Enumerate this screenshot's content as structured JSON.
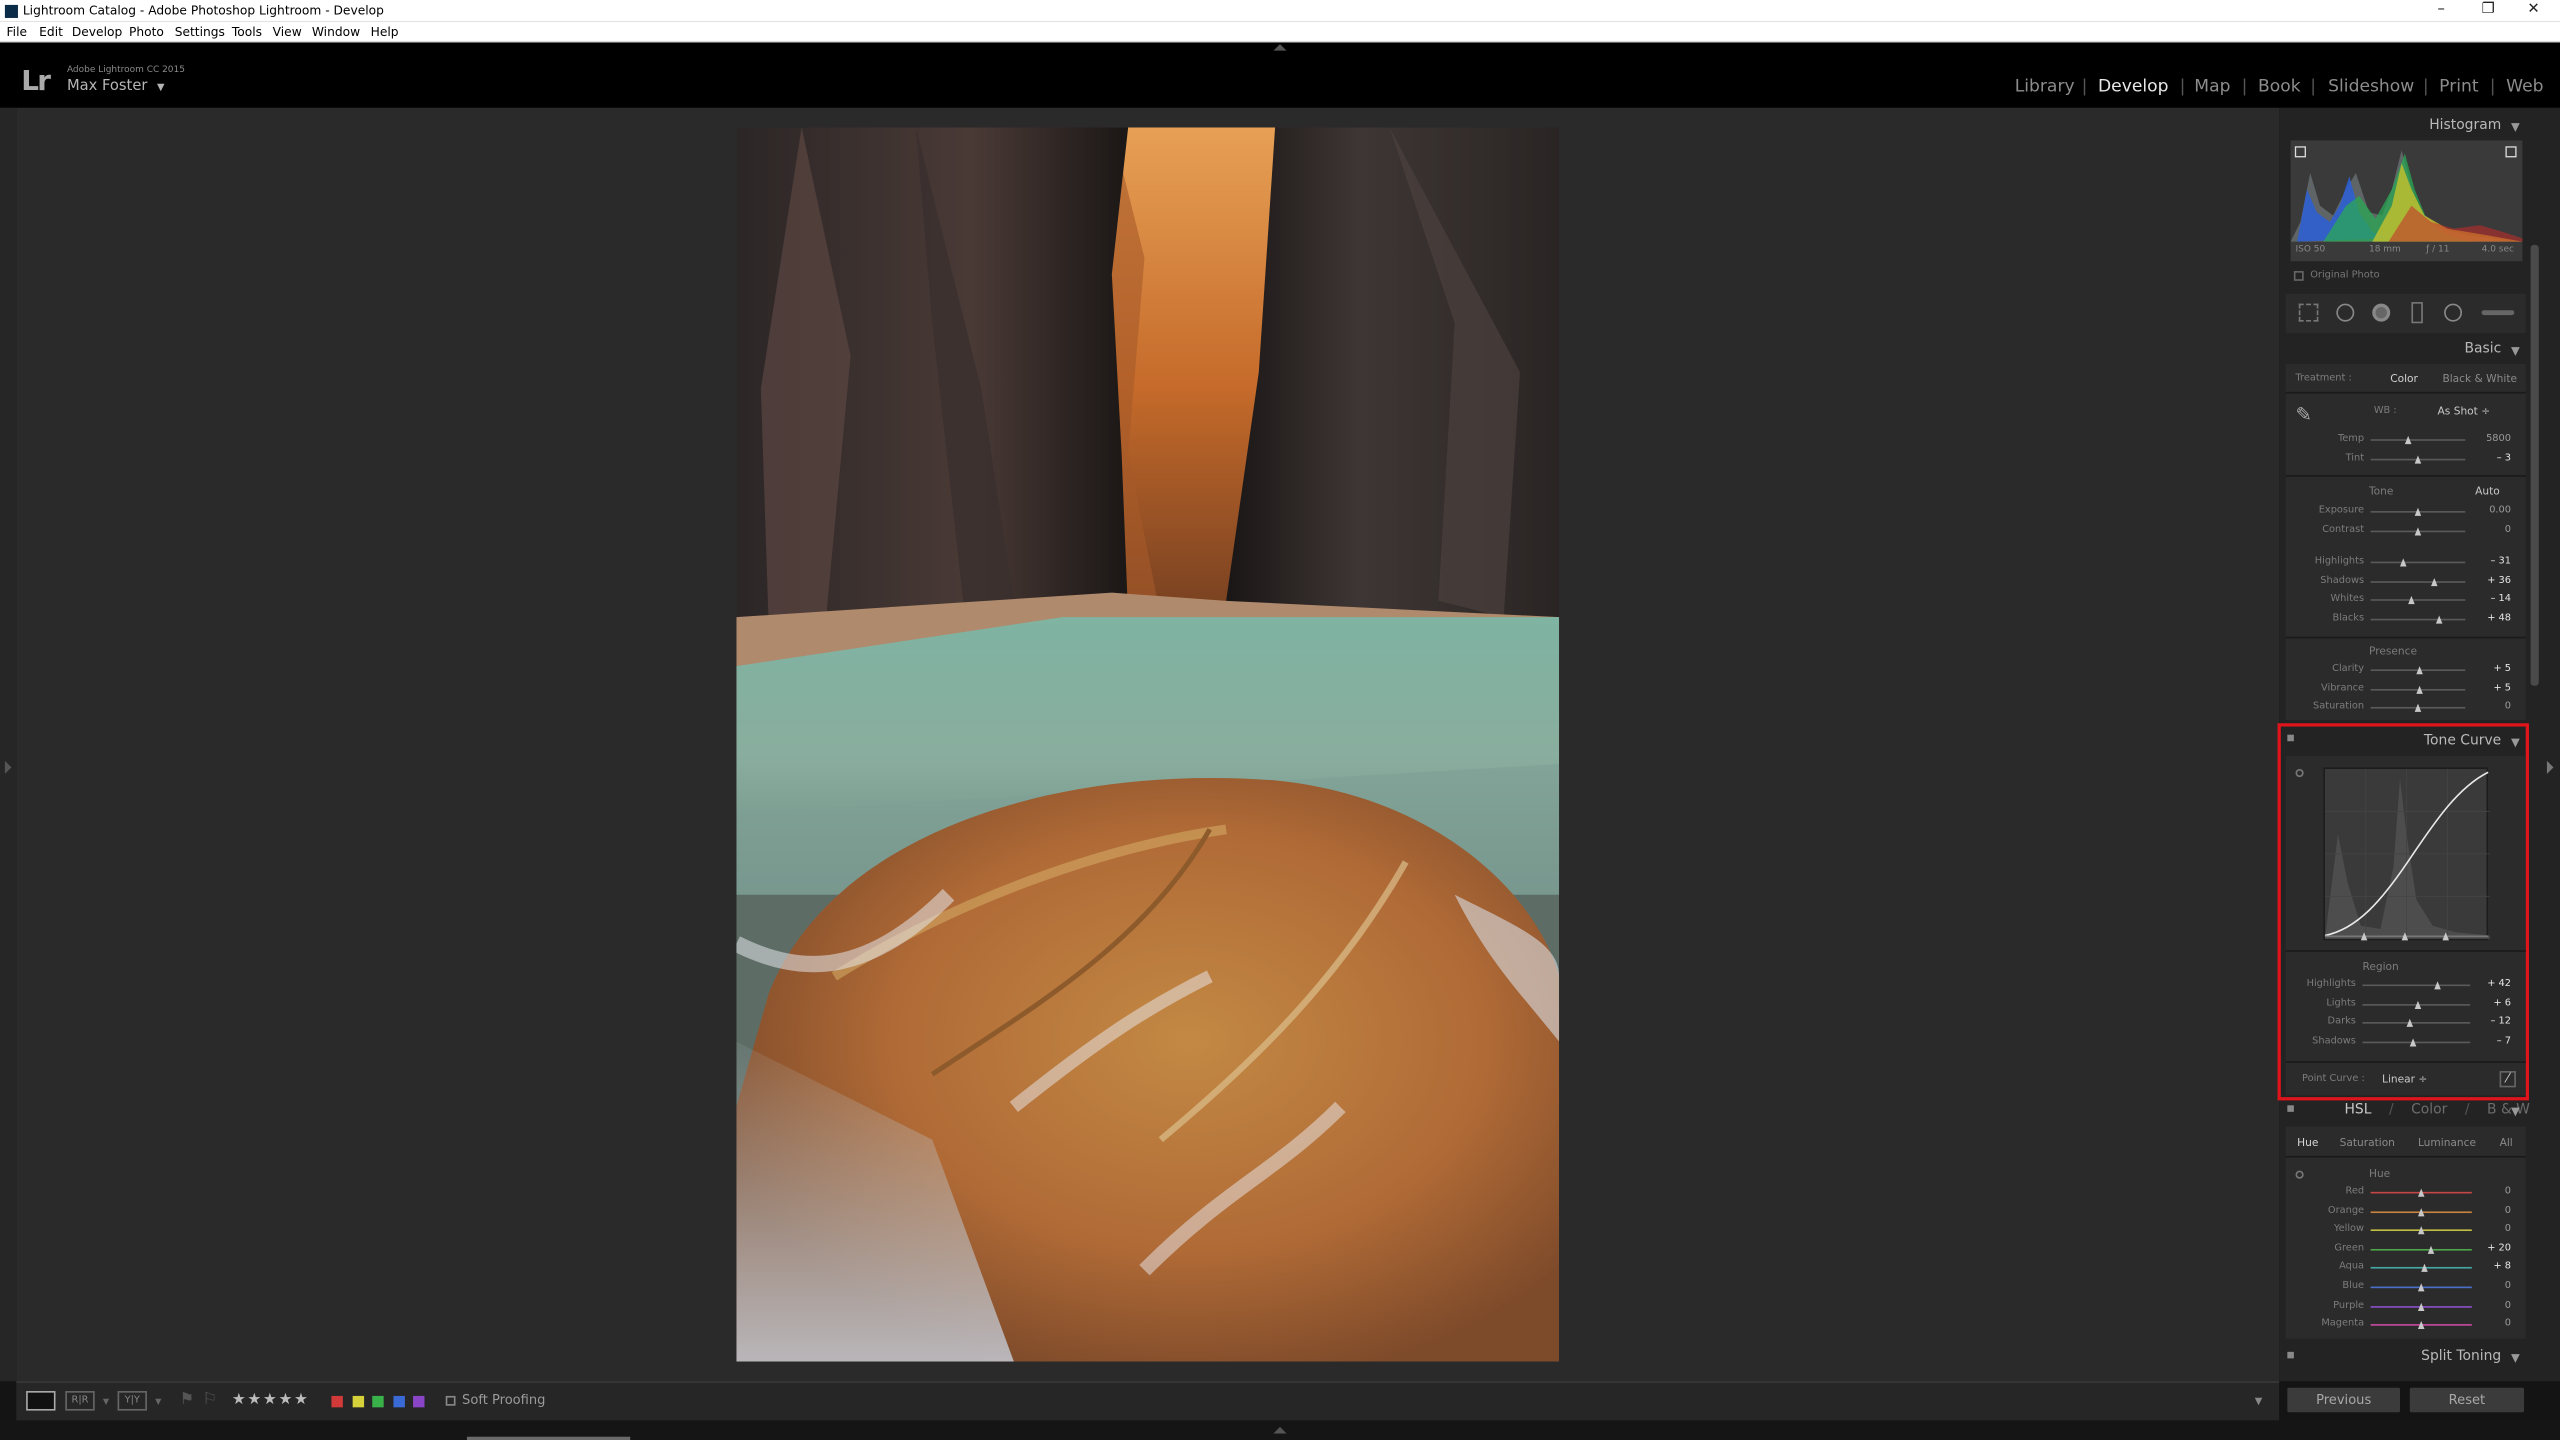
{
  "window": {
    "title": "Lightroom Catalog - Adobe Photoshop Lightroom - Develop",
    "controls": [
      "–",
      "❐",
      "✕"
    ]
  },
  "menu": [
    "File",
    "Edit",
    "Develop",
    "Photo",
    "Settings",
    "Tools",
    "View",
    "Window",
    "Help"
  ],
  "identity": {
    "logo": "Lr",
    "product": "Adobe Lightroom CC 2015",
    "user": "Max Foster",
    "user_caret": "▼"
  },
  "modules": [
    {
      "label": "Library",
      "active": false
    },
    {
      "label": "Develop",
      "active": true
    },
    {
      "label": "Map",
      "active": false
    },
    {
      "label": "Book",
      "active": false
    },
    {
      "label": "Slideshow",
      "active": false
    },
    {
      "label": "Print",
      "active": false
    },
    {
      "label": "Web",
      "active": false
    }
  ],
  "histogram": {
    "title": "Histogram",
    "iso": "ISO 50",
    "focal": "18 mm",
    "aperture": "ƒ / 11",
    "shutter": "4.0 sec",
    "original_photo": "Original Photo"
  },
  "basic": {
    "title": "Basic",
    "treatment_label": "Treatment :",
    "treatment_color": "Color",
    "treatment_bw": "Black & White",
    "wb_label": "WB :",
    "wb_value": "As Shot ÷",
    "wb": [
      {
        "label": "Temp",
        "value": "5800",
        "pos": 0.4
      },
      {
        "label": "Tint",
        "value": "– 3",
        "pos": 0.5
      }
    ],
    "tone_label": "Tone",
    "auto": "Auto",
    "tone": [
      {
        "label": "Exposure",
        "value": "0.00",
        "pos": 0.5
      },
      {
        "label": "Contrast",
        "value": "0",
        "pos": 0.5
      }
    ],
    "tone2": [
      {
        "label": "Highlights",
        "value": "– 31",
        "pos": 0.36
      },
      {
        "label": "Shadows",
        "value": "+ 36",
        "pos": 0.68
      },
      {
        "label": "Whites",
        "value": "– 14",
        "pos": 0.44
      },
      {
        "label": "Blacks",
        "value": "+ 48",
        "pos": 0.74
      }
    ],
    "presence_label": "Presence",
    "presence": [
      {
        "label": "Clarity",
        "value": "+ 5",
        "pos": 0.52
      },
      {
        "label": "Vibrance",
        "value": "+ 5",
        "pos": 0.52
      },
      {
        "label": "Saturation",
        "value": "0",
        "pos": 0.5
      }
    ]
  },
  "tone_curve": {
    "title": "Tone Curve",
    "region_label": "Region",
    "regions": [
      {
        "label": "Highlights",
        "value": "+ 42",
        "pos": 0.71
      },
      {
        "label": "Lights",
        "value": "+ 6",
        "pos": 0.53
      },
      {
        "label": "Darks",
        "value": "– 12",
        "pos": 0.44
      },
      {
        "label": "Shadows",
        "value": "– 7",
        "pos": 0.47
      }
    ],
    "point_curve_label": "Point Curve :",
    "point_curve_value": "Linear ÷",
    "highlight_color": "#e0141b"
  },
  "hsl": {
    "title_hsl": "HSL",
    "sep": "/",
    "title_color": "Color",
    "title_bw": "B & W",
    "tabs": [
      {
        "label": "Hue",
        "active": true
      },
      {
        "label": "Saturation",
        "active": false
      },
      {
        "label": "Luminance",
        "active": false
      },
      {
        "label": "All",
        "active": false
      }
    ],
    "section_label": "Hue",
    "rows": [
      {
        "label": "Red",
        "value": "0",
        "pos": 0.5,
        "color": "#c64646"
      },
      {
        "label": "Orange",
        "value": "0",
        "pos": 0.5,
        "color": "#c8843e"
      },
      {
        "label": "Yellow",
        "value": "0",
        "pos": 0.5,
        "color": "#c3bf44"
      },
      {
        "label": "Green",
        "value": "+ 20",
        "pos": 0.6,
        "color": "#4fa64a"
      },
      {
        "label": "Aqua",
        "value": "+ 8",
        "pos": 0.54,
        "color": "#44a8a4"
      },
      {
        "label": "Blue",
        "value": "0",
        "pos": 0.5,
        "color": "#4a6fc6"
      },
      {
        "label": "Purple",
        "value": "0",
        "pos": 0.5,
        "color": "#8a50c6"
      },
      {
        "label": "Magenta",
        "value": "0",
        "pos": 0.5,
        "color": "#c64aa0"
      }
    ]
  },
  "split_toning": {
    "title": "Split Toning"
  },
  "buttons": {
    "previous": "Previous",
    "reset": "Reset"
  },
  "toolbar": {
    "stars": "★★★★★",
    "soft_proofing": "Soft Proofing",
    "labels": [
      "#d23a3a",
      "#d6d03a",
      "#3ab24a",
      "#3a6ad6",
      "#8a44c6"
    ]
  }
}
